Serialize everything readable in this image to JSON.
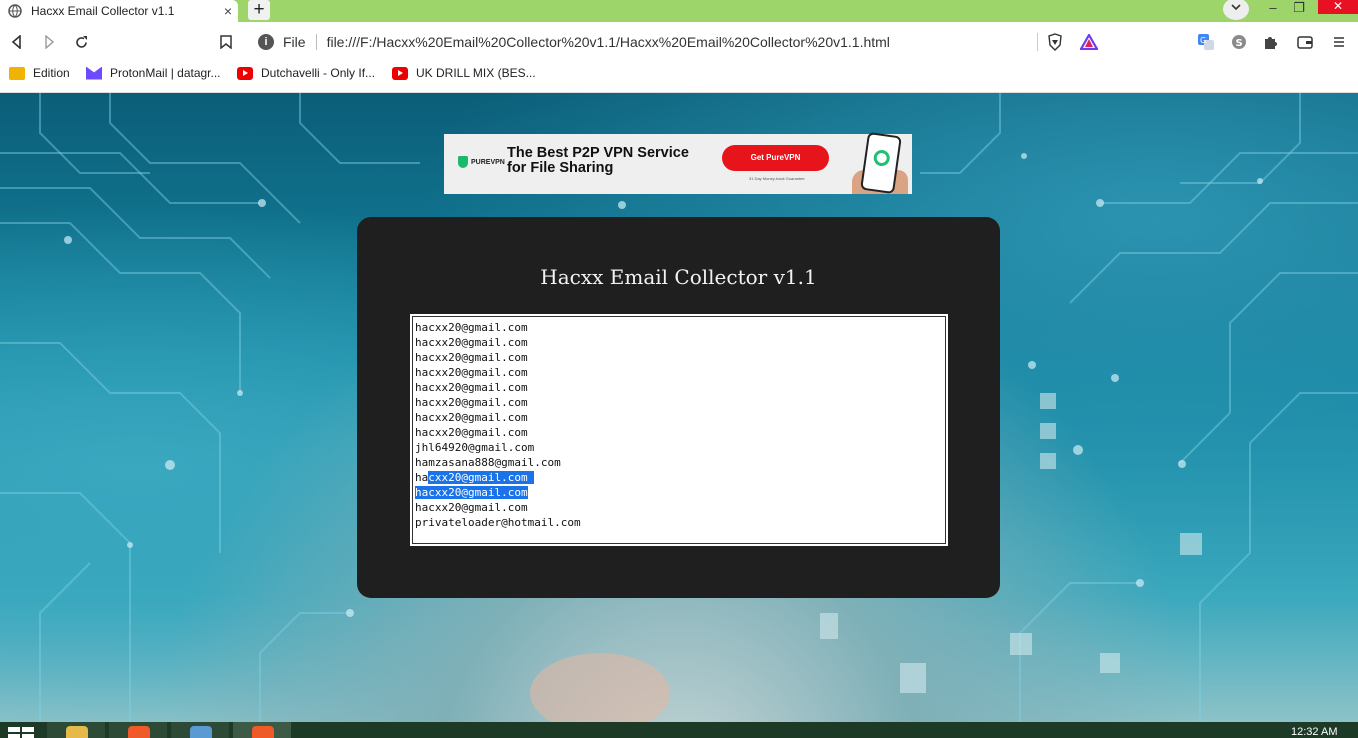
{
  "browser": {
    "tab_title": "Hacxx Email Collector v1.1",
    "tab_close": "×",
    "new_tab": "+",
    "url_scheme": "File",
    "url": "file:///F:/Hacxx%20Email%20Collector%20v1.1/Hacxx%20Email%20Collector%20v1.1.html",
    "window_controls": {
      "minimize": "–",
      "maximize": "❐",
      "close": "✕"
    }
  },
  "bookmarks": [
    {
      "label": "Edition",
      "icon": "folder-icon"
    },
    {
      "label": "ProtonMail | datagr...",
      "icon": "protonmail-icon"
    },
    {
      "label": "Dutchavelli - Only If...",
      "icon": "youtube-icon"
    },
    {
      "label": "UK DRILL MIX (BES...",
      "icon": "youtube-icon"
    }
  ],
  "ad": {
    "brand": "PUREVPN",
    "headline_line1": "The Best P2P VPN Service",
    "headline_line2": "for File Sharing",
    "cta": "Get PureVPN",
    "fine_print": "31 Day Money-back Guarantee"
  },
  "app": {
    "title": "Hacxx Email Collector v1.1",
    "emails": [
      {
        "pre": "hacxx20@gmail.com",
        "sel": "",
        "post": ""
      },
      {
        "pre": "hacxx20@gmail.com",
        "sel": "",
        "post": ""
      },
      {
        "pre": "hacxx20@gmail.com",
        "sel": "",
        "post": ""
      },
      {
        "pre": "hacxx20@gmail.com",
        "sel": "",
        "post": ""
      },
      {
        "pre": "hacxx20@gmail.com",
        "sel": "",
        "post": ""
      },
      {
        "pre": "hacxx20@gmail.com",
        "sel": "",
        "post": ""
      },
      {
        "pre": "hacxx20@gmail.com",
        "sel": "",
        "post": ""
      },
      {
        "pre": "hacxx20@gmail.com",
        "sel": "",
        "post": ""
      },
      {
        "pre": "jhl64920@gmail.com",
        "sel": "",
        "post": ""
      },
      {
        "pre": "hamzasana888@gmail.com",
        "sel": "",
        "post": ""
      },
      {
        "pre": "ha",
        "sel": "cxx20@gmail.com ",
        "post": ""
      },
      {
        "pre": "",
        "sel": "hacxx20@gmail.com",
        "post": ""
      },
      {
        "pre": "hacxx20@gmail.com",
        "sel": "",
        "post": ""
      },
      {
        "pre": "privateloader@hotmail.com",
        "sel": "",
        "post": ""
      }
    ]
  },
  "taskbar": {
    "clock": "12:32 AM"
  },
  "colors": {
    "tabstrip": "#9ed56b",
    "panel": "#1f1f1f",
    "selection": "#1a73e8",
    "cta": "#e8141c"
  }
}
